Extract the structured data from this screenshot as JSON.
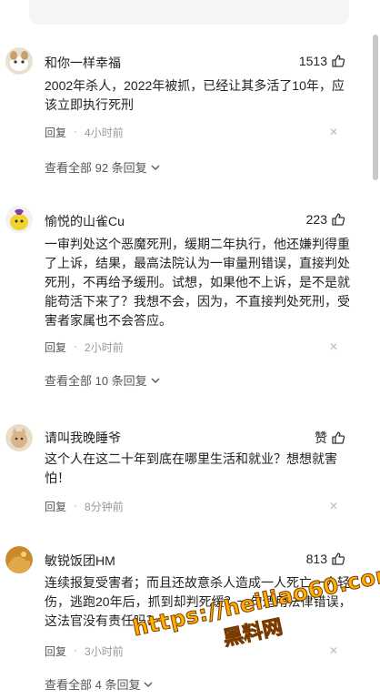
{
  "comments": [
    {
      "name": "和你一样幸福",
      "likes": "1513",
      "text": "2002年杀人，2022年被抓，已经让其多活了10年，应该立即执行死刑",
      "reply": "回复",
      "time": "4小时前",
      "more": "查看全部 92 条回复"
    },
    {
      "name": "愉悦的山雀Cu",
      "likes": "223",
      "text": "一审判处这个恶魔死刑，缓期二年执行，他还嫌判得重了上诉，结果，最高法院认为一审量刑错误，直接判处死刑，不再给予缓刑。试想，如果他不上诉，是不是就能苟活下来了？我想不会，因为，不直接判处死刑，受害者家属也不会答应。",
      "reply": "回复",
      "time": "2小时前",
      "more": "查看全部 10 条回复"
    },
    {
      "name": "请叫我晚睡爷",
      "likes": "赞",
      "text": "这个人在这二十年到底在哪里生活和就业？想想就害怕！",
      "reply": "回复",
      "time": "8分钟前"
    },
    {
      "name": "敏锐饭团HM",
      "likes": "813",
      "text": "连续报复受害者；而且还故意杀人造成一人死亡一人轻伤，逃跑20年后，抓到却判死缓？一句适用法律错误，这法官没有责任吗？",
      "reply": "回复",
      "time": "3小时前",
      "more": "查看全部 4 条回复"
    }
  ],
  "watermark": {
    "line1": "https://heiliao60.com",
    "line2": "黑料网"
  }
}
